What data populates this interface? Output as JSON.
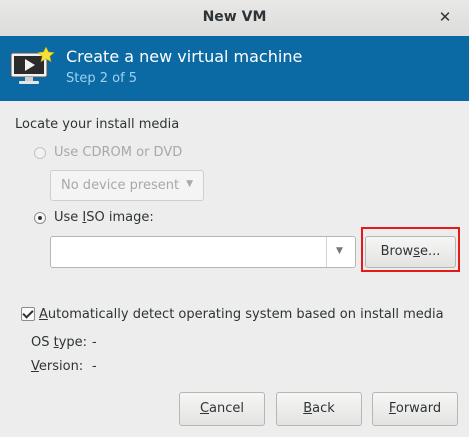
{
  "window": {
    "title": "New VM",
    "close_glyph": "✕"
  },
  "header": {
    "title": "Create a new virtual machine",
    "step": "Step 2 of 5",
    "icon": "monitor-with-star-icon"
  },
  "media": {
    "section_label": "Locate your install media",
    "cdrom_label": "Use CDROM or DVD",
    "cdrom_device_value": "No device present",
    "iso_label_pre": "Use ",
    "iso_label_mnemonic": "I",
    "iso_label_post": "SO image:",
    "iso_path_value": "",
    "browse_pre": "Brow",
    "browse_mnemonic": "s",
    "browse_post": "e..."
  },
  "os_detect": {
    "checkbox_mnemonic": "A",
    "checkbox_label_post": "utomatically detect operating system based on install media",
    "os_type_pre": "OS ",
    "os_type_mnemonic": "t",
    "os_type_post": "ype:",
    "os_type_value": "-",
    "version_mnemonic": "V",
    "version_post": "ersion:",
    "version_value": "-"
  },
  "footer": {
    "cancel_mnemonic": "C",
    "cancel_post": "ancel",
    "back_mnemonic": "B",
    "back_post": "ack",
    "forward_mnemonic": "F",
    "forward_post": "orward"
  },
  "colors": {
    "header_bg": "#0b6aa3",
    "step_text": "#9fd0f0",
    "highlight_box": "#e31b1b"
  }
}
